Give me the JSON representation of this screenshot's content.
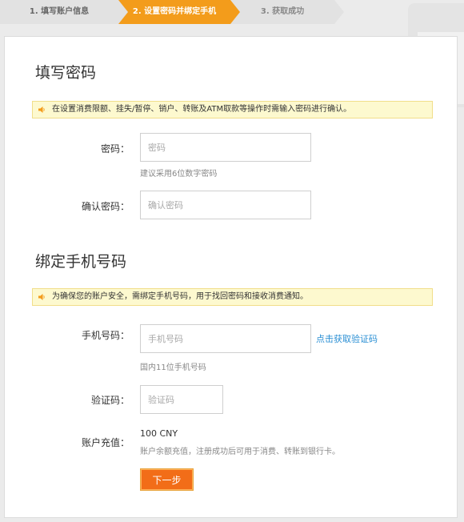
{
  "steps": [
    {
      "label": "1. 填写账户信息"
    },
    {
      "label": "2. 设置密码并绑定手机"
    },
    {
      "label": "3. 获取成功"
    }
  ],
  "password_section": {
    "title": "填写密码",
    "notice": "在设置消费限额、挂失/暂停、销户、转账及ATM取款等操作时需输入密码进行确认。",
    "password_label": "密码：",
    "password_placeholder": "密码",
    "password_hint": "建议采用6位数字密码",
    "confirm_label": "确认密码：",
    "confirm_placeholder": "确认密码"
  },
  "phone_section": {
    "title": "绑定手机号码",
    "notice": "为确保您的账户安全，需绑定手机号码，用于找回密码和接收消费通知。",
    "phone_label": "手机号码：",
    "phone_placeholder": "手机号码",
    "get_code_link": "点击获取验证码",
    "phone_hint": "国内11位手机号码",
    "code_label": "验证码：",
    "code_placeholder": "验证码",
    "recharge_label": "账户充值：",
    "recharge_amount": "100 CNY",
    "recharge_hint": "账户余额充值，注册成功后可用于消费、转账到银行卡。",
    "next_button": "下一步"
  },
  "colors": {
    "accent": "#f39c1b",
    "button": "#f26d18",
    "link": "#2a8fd4",
    "notice_bg": "#fdf9cf"
  },
  "icons": {
    "notice": "speaker-icon"
  }
}
